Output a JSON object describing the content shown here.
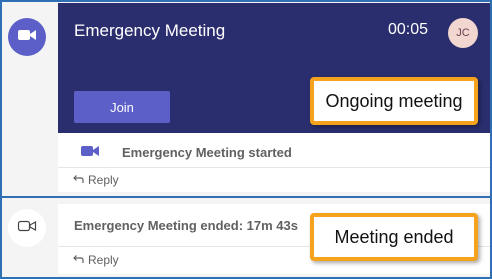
{
  "meeting": {
    "title": "Emergency Meeting",
    "timer": "00:05",
    "participant_initials": "JC",
    "join_label": "Join"
  },
  "started": {
    "text": "Emergency Meeting started",
    "reply_label": "Reply"
  },
  "ended": {
    "text": "Emergency Meeting ended: 17m 43s",
    "reply_label": "Reply"
  },
  "annotations": {
    "ongoing": "Ongoing meeting",
    "ended": "Meeting ended"
  },
  "colors": {
    "accent": "#5b5fc7",
    "card_bg": "#2b2e6e",
    "callout_border": "#f5a21d",
    "frame_border": "#2f6fb3"
  }
}
